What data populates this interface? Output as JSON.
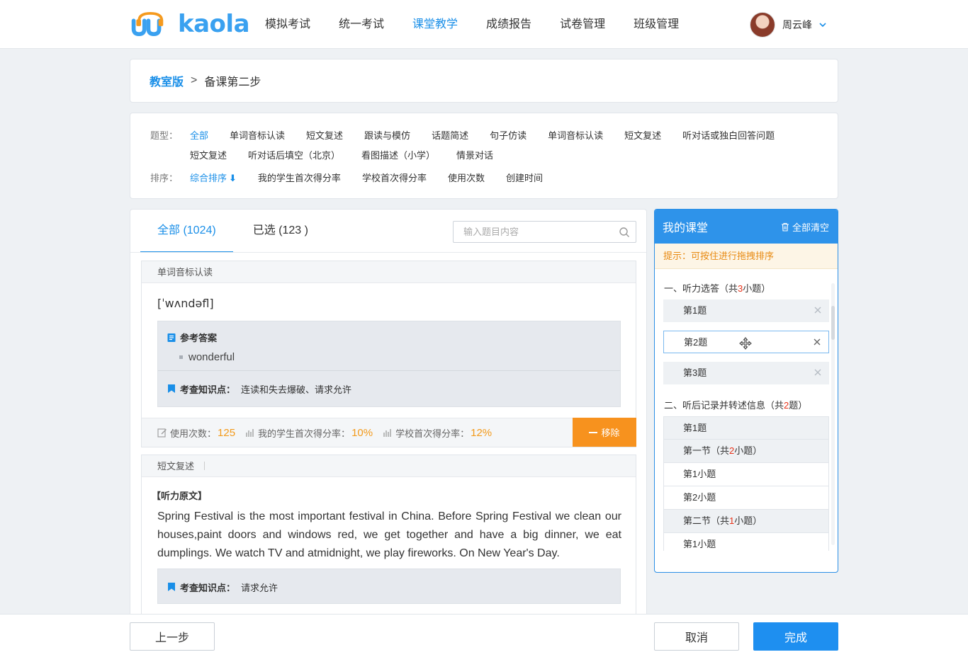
{
  "brand": {
    "name": "kaola",
    "accent": "#1a8fe8"
  },
  "nav": {
    "items": [
      "模拟考试",
      "统一考试",
      "课堂教学",
      "成绩报告",
      "试卷管理",
      "班级管理"
    ],
    "active_index": 2
  },
  "user": {
    "name": "周云峰"
  },
  "breadcrumb": {
    "root": "教室版",
    "separator": ">",
    "current": "备课第二步"
  },
  "filters": {
    "type_label": "题型：",
    "types_row1": [
      "全部",
      "单词音标认读",
      "短文复述",
      "跟读与模仿",
      "话题简述",
      "句子仿读",
      "单词音标认读",
      "短文复述",
      "听对话或独白回答问题"
    ],
    "types_row2": [
      "短文复述",
      "听对话后填空（北京）",
      "看图描述（小学）",
      "情景对话"
    ],
    "sort_label": "排序：",
    "sorts": [
      "综合排序",
      "我的学生首次得分率",
      "学校首次得分率",
      "使用次数",
      "创建时间"
    ]
  },
  "tabs": {
    "all": "全部 (1024)",
    "selected": "已选 (123 )"
  },
  "search": {
    "placeholder": "输入题目内容",
    "value": ""
  },
  "questions": [
    {
      "type": "单词音标认读",
      "phonetic": "[ˈwʌndəfl]",
      "answer_title": "参考答案",
      "answer": "wonderful",
      "kp_label": "考查知识点：",
      "kp_value": "连读和失去爆破、请求允许",
      "stats": {
        "usage_label": "使用次数：",
        "usage": "125",
        "my_rate_label": "我的学生首次得分率：",
        "my_rate": "10%",
        "school_rate_label": "学校首次得分率：",
        "school_rate": "12%"
      },
      "remove_label": "移除"
    },
    {
      "type": "短文复述",
      "orig_title": "【听力原文】",
      "passage": "Spring Festival is the most important festival in China. Before Spring Festival we clean our houses,paint doors and windows red, we get together and have a big dinner, we eat dumplings. We watch TV and atmidnight, we play fireworks. On New Year's Day.",
      "kp_label": "考查知识点：",
      "kp_value": "请求允许"
    }
  ],
  "classroom": {
    "title": "我的课堂",
    "clear_label": "全部清空",
    "tip": "提示：可按住进行拖拽排序",
    "section1": {
      "prefix": "一、听力选答（共",
      "count": "3",
      "suffix": "小题）"
    },
    "section1_items": [
      "第1题",
      "第2题",
      "第3题"
    ],
    "section2": {
      "prefix": "二、听后记录并转述信息（共",
      "count": "2",
      "suffix": "题）"
    },
    "tree": [
      {
        "text": "第1题"
      },
      {
        "prefix": "第一节（共",
        "count": "2",
        "suffix": "小题）"
      },
      {
        "text": "第1小题"
      },
      {
        "text": "第2小题"
      },
      {
        "prefix": "第二节（共",
        "count": "1",
        "suffix": "小题）"
      },
      {
        "text": "第1小题"
      }
    ]
  },
  "footer": {
    "prev": "上一步",
    "cancel": "取消",
    "done": "完成"
  },
  "colors": {
    "orange": "#f7921e",
    "blue": "#1e8ff0",
    "red": "#e8331a"
  }
}
